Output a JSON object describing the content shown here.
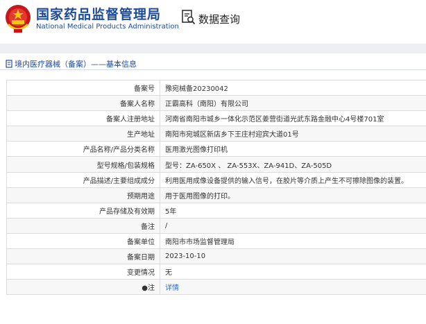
{
  "header": {
    "title_cn": "国家药品监督管理局",
    "title_en": "National Medical Products Administration",
    "search_label": "数据查询"
  },
  "breadcrumb": {
    "text": "境内医疗器械（备案）——基本信息"
  },
  "rows": [
    {
      "label": "备案号",
      "value": "豫宛械备20230042"
    },
    {
      "label": "备案人名称",
      "value": "正霸高科（南阳）有限公司"
    },
    {
      "label": "备案人注册地址",
      "value": "河南省南阳市城乡一体化示范区姜营街道光武东路金融中心4号楼701室"
    },
    {
      "label": "生产地址",
      "value": "南阳市宛城区新店乡下王庄村迎宾大道01号"
    },
    {
      "label": "产品名称/产品分类名称",
      "value": "医用激光图像打印机"
    },
    {
      "label": "型号规格/包装规格",
      "value": "型号：ZA-650X 、 ZA-553X、ZA-941D、ZA-505D"
    },
    {
      "label": "产品描述/主要组成成分",
      "value": "利用医用成像设备提供的输入信号，在胶片等介质上产生不可擦除图像的装置。"
    },
    {
      "label": "预期用途",
      "value": "用于医用图像的打印。"
    },
    {
      "label": "产品存储及有效期",
      "value": "5年"
    },
    {
      "label": "备注",
      "value": "/"
    },
    {
      "label": "备案单位",
      "value": "南阳市市场监督管理局"
    },
    {
      "label": "备案日期",
      "value": "2023-10-10"
    },
    {
      "label": "变更情况",
      "value": "无"
    },
    {
      "label": "注",
      "value": "详情"
    }
  ],
  "icons": {
    "emblem": "national-emblem-icon",
    "search": "search-document-icon",
    "breadcrumb": "document-icon",
    "note": "bullet-icon"
  },
  "colors": {
    "brand_blue": "#1e4a9a",
    "link": "#2d6fd0",
    "emblem_red": "#c8161d"
  }
}
